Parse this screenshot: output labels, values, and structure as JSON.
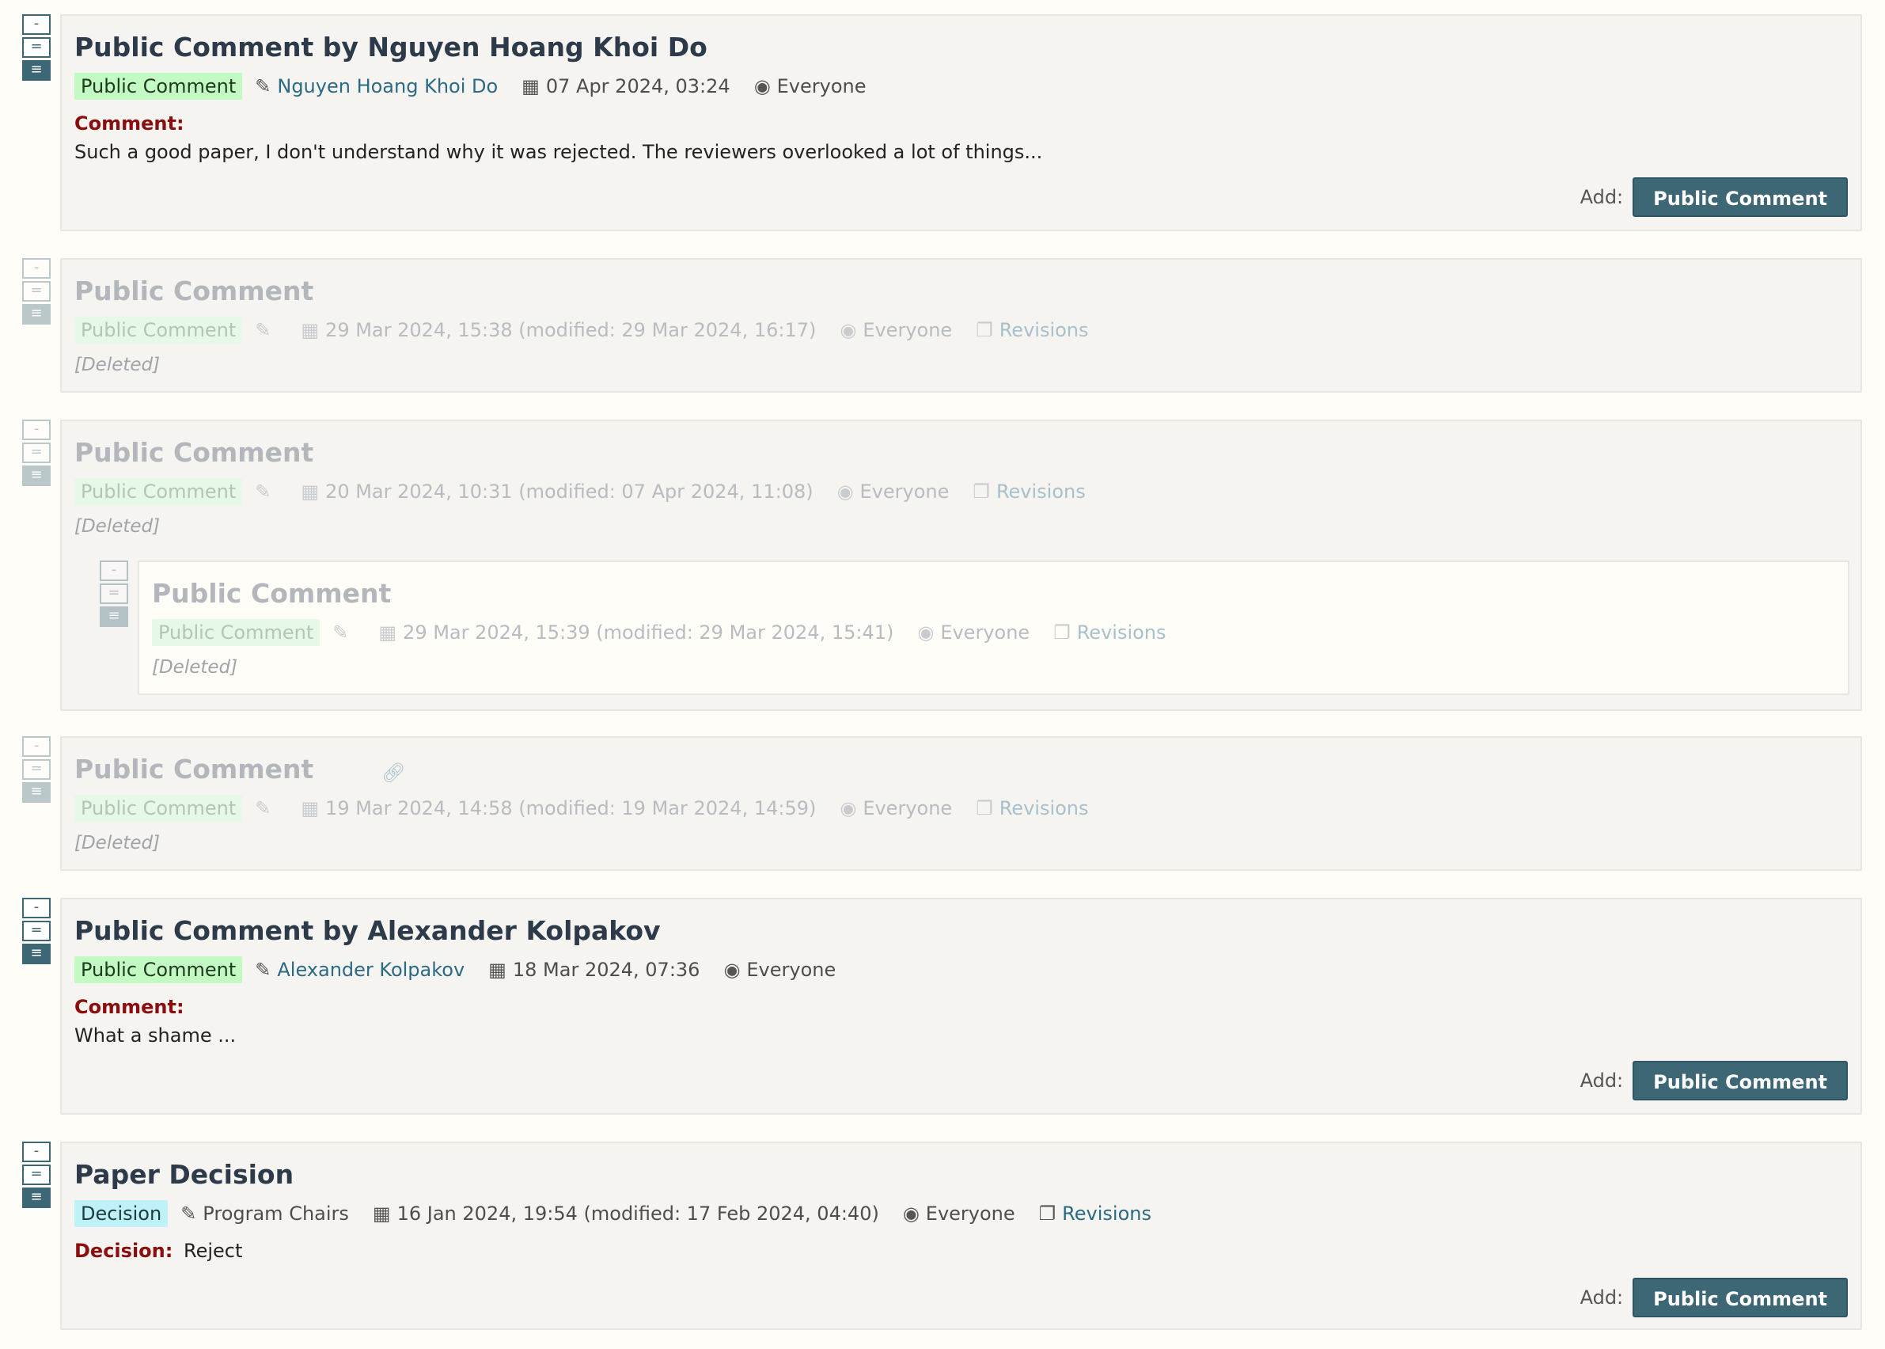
{
  "notes": [
    {
      "title": "Public Comment by Nguyen Hoang Khoi Do",
      "badge": "Public Comment",
      "author": "Nguyen Hoang Khoi Do",
      "date": "07 Apr 2024, 03:24",
      "visibility": "Everyone",
      "label": "Comment:",
      "text": "Such a good paper, I don't understand why it was rejected. The reviewers overlooked a lot of things...",
      "add_label": "Add:",
      "add_button": "Public Comment"
    },
    {
      "title": "Public Comment",
      "badge": "Public Comment",
      "date": "29 Mar 2024, 15:38 (modified: 29 Mar 2024, 16:17)",
      "visibility": "Everyone",
      "revisions": "Revisions",
      "deleted": "[Deleted]"
    },
    {
      "title": "Public Comment",
      "badge": "Public Comment",
      "date": "20 Mar 2024, 10:31 (modified: 07 Apr 2024, 11:08)",
      "visibility": "Everyone",
      "revisions": "Revisions",
      "deleted": "[Deleted]",
      "reply": {
        "title": "Public Comment",
        "badge": "Public Comment",
        "date": "29 Mar 2024, 15:39 (modified: 29 Mar 2024, 15:41)",
        "visibility": "Everyone",
        "revisions": "Revisions",
        "deleted": "[Deleted]"
      }
    },
    {
      "title": "Public Comment",
      "badge": "Public Comment",
      "date": "19 Mar 2024, 14:58 (modified: 19 Mar 2024, 14:59)",
      "visibility": "Everyone",
      "revisions": "Revisions",
      "deleted": "[Deleted]"
    },
    {
      "title": "Public Comment by Alexander Kolpakov",
      "badge": "Public Comment",
      "author": "Alexander Kolpakov",
      "date": "18 Mar 2024, 07:36",
      "visibility": "Everyone",
      "label": "Comment:",
      "text": "What a shame ...",
      "add_label": "Add:",
      "add_button": "Public Comment"
    },
    {
      "title": "Paper Decision",
      "badge": "Decision",
      "author": "Program Chairs",
      "date": "16 Jan 2024, 19:54 (modified: 17 Feb 2024, 04:40)",
      "visibility": "Everyone",
      "revisions": "Revisions",
      "label": "Decision:",
      "text": "Reject",
      "add_label": "Add:",
      "add_button": "Public Comment"
    }
  ],
  "collapse_labels": [
    "-",
    "=",
    "≡"
  ],
  "icons": {
    "pencil": "pencil-icon",
    "calendar": "calendar-icon",
    "eye": "eye-icon",
    "revisions": "revisions-icon",
    "link": "link-icon"
  }
}
